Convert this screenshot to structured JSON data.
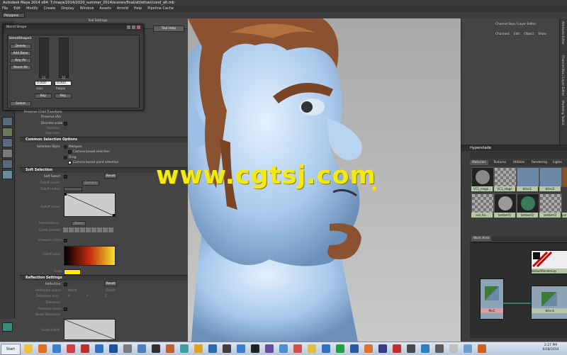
{
  "window": {
    "title": "Autodesk Maya 2014 x64: T:/maya/2014/2020_summer_2014/scenes/final/alt/ethan/cond_alt.mb"
  },
  "menubar": [
    "File",
    "Edit",
    "Modify",
    "Create",
    "Display",
    "Window",
    "Assets",
    "Arnold",
    "Help",
    "Pipeline Cache"
  ],
  "status": {
    "mode": "Polygons"
  },
  "tool_settings": {
    "title": "Tool Settings",
    "tool_help": "Tool Help"
  },
  "blend_shape": {
    "window_title": "Blend Shape",
    "section": "blendShape1",
    "buttons": [
      "Delete",
      "Add Base",
      "Key All",
      "Reset All"
    ],
    "weights": [
      {
        "value_label": "0.000",
        "name": "sour",
        "key": "Key",
        "slider_index": "21"
      },
      {
        "value_label": "0.000",
        "name": "happy",
        "key": "Key",
        "slider_index": "22"
      }
    ],
    "select_label": "Select"
  },
  "panel": {
    "rows_top": [
      "Preserve Child Transform",
      "Preserve UVs",
      "Discrete scale",
      "Rotation",
      "Step size"
    ],
    "common": {
      "header": "Common Selection Options",
      "style_label": "Selection Style:",
      "marquee": "Marquee",
      "camera_based": "Camera based selection",
      "drag": "Drag",
      "paint": "Camera based paint selection"
    },
    "soft": {
      "header": "Soft Selection",
      "soft_select": "Soft Select",
      "reset": "Reset",
      "falloff_mode": "Falloff mode:",
      "falloff_mode_val": "Surface",
      "falloff_radius": "Falloff radius:",
      "falloff_curve": "Falloff curve:",
      "interpolation": "Interpolation:",
      "interp_val": "None",
      "curve_presets": "Curve presets:",
      "viewport_colors": "Viewport colors:",
      "falloff_color": "Falloff color:",
      "color": "Color:"
    },
    "reflection": {
      "header": "Reflection Settings",
      "reflection": "Reflection:",
      "reset": "Reset",
      "space": "Reflection space:",
      "world": "World",
      "object": "Object",
      "axis": "Reflection axis:",
      "x": "X",
      "y": "Y",
      "z": "Z",
      "tolerance": "Tolerance:",
      "preserve": "Preserve seam:",
      "seam_tol": "Seam Tolerance:",
      "seam_falloff": "Seam falloff:"
    }
  },
  "channel_box": {
    "title": "Channel Box / Layer Editor",
    "menu": [
      "Channels",
      "Edit",
      "Object",
      "Show"
    ]
  },
  "side_tabs": [
    "Attribute Editor",
    "Channel Box / Layer Editor",
    "Modeling Toolkit"
  ],
  "hypershade": {
    "title": "Hypershade",
    "tabs": [
      "Materials",
      "Textures",
      "Utilities",
      "Rendering",
      "Lights"
    ],
    "row1": [
      "VC1_magn..",
      "VC1_stage",
      "blinn1",
      "blinn2",
      "blinn3"
    ],
    "row2": [
      "sve_for...",
      "lambert1",
      "lambert2",
      "lambert3",
      "part"
    ],
    "work_area": "Work Area",
    "node_file": "file1",
    "node_default": "defaultRenderLay",
    "node_blinn": "blinn1"
  },
  "watermark": "www.cgtsj.com",
  "taskbar": {
    "start": "Start",
    "time": "2:27 PM",
    "date": "6/28/2014"
  },
  "colors": {
    "falloff_gradient_start": "#000000",
    "falloff_gradient_mid": "#c42a10",
    "falloff_gradient_end": "#f5e22a",
    "yellow_swatch": "#ffee00",
    "watermark": "#f2ea10"
  }
}
